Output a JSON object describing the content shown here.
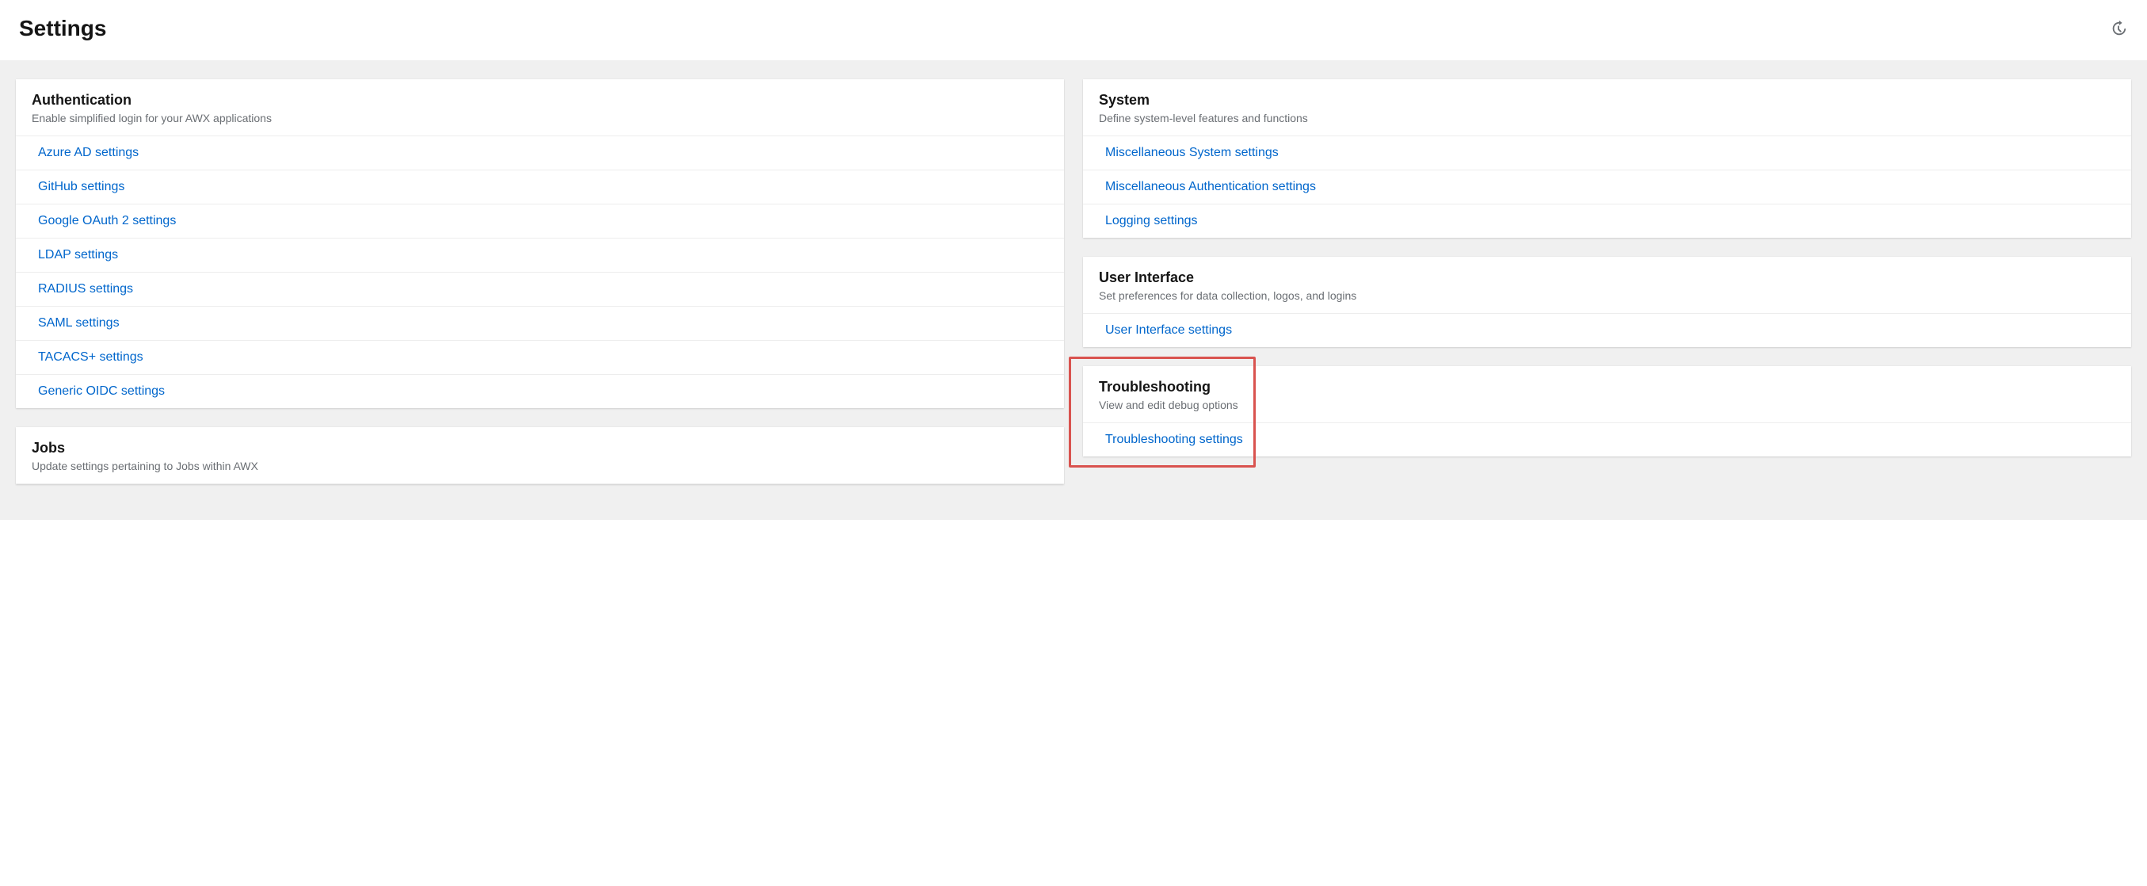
{
  "header": {
    "title": "Settings",
    "history_icon": "history-icon"
  },
  "left": [
    {
      "id": "authentication",
      "title": "Authentication",
      "desc": "Enable simplified login for your AWX applications",
      "items": [
        "Azure AD settings",
        "GitHub settings",
        "Google OAuth 2 settings",
        "LDAP settings",
        "RADIUS settings",
        "SAML settings",
        "TACACS+ settings",
        "Generic OIDC settings"
      ]
    },
    {
      "id": "jobs",
      "title": "Jobs",
      "desc": "Update settings pertaining to Jobs within AWX",
      "items": []
    }
  ],
  "right": [
    {
      "id": "system",
      "title": "System",
      "desc": "Define system-level features and functions",
      "items": [
        "Miscellaneous System settings",
        "Miscellaneous Authentication settings",
        "Logging settings"
      ]
    },
    {
      "id": "user-interface",
      "title": "User Interface",
      "desc": "Set preferences for data collection, logos, and logins",
      "items": [
        "User Interface settings"
      ]
    },
    {
      "id": "troubleshooting",
      "title": "Troubleshooting",
      "desc": "View and edit debug options",
      "items": [
        "Troubleshooting settings"
      ],
      "highlighted": true
    }
  ]
}
